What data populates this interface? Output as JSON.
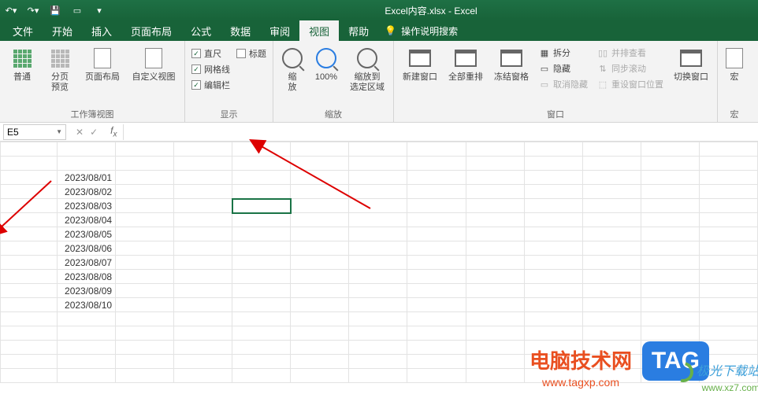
{
  "title": "Excel内容.xlsx - Excel",
  "tabs": {
    "file": "文件",
    "home": "开始",
    "insert": "插入",
    "layout": "页面布局",
    "formula": "公式",
    "data": "数据",
    "review": "审阅",
    "view": "视图",
    "help": "帮助",
    "search": "操作说明搜索"
  },
  "ribbon": {
    "groups": {
      "workbook_views": {
        "label": "工作簿视图",
        "normal": "普通",
        "page_break": "分页\n预览",
        "page_layout": "页面布局",
        "custom": "自定义视图"
      },
      "show": {
        "label": "显示",
        "ruler": "直尺",
        "gridlines": "网格线",
        "formulabar": "编辑栏",
        "headings": "标题"
      },
      "zoom": {
        "label": "缩放",
        "zoom": "缩\n放",
        "hundred": "100%",
        "selection": "缩放到\n选定区域"
      },
      "window": {
        "label": "窗口",
        "new_win": "新建窗口",
        "arrange": "全部重排",
        "freeze": "冻结窗格",
        "split": "拆分",
        "hide": "隐藏",
        "unhide": "取消隐藏",
        "side": "并排查看",
        "sync": "同步滚动",
        "reset": "重设窗口位置",
        "switch": "切换窗口"
      },
      "macro": {
        "label": "宏",
        "macro": "宏"
      }
    }
  },
  "namebox": "E5",
  "cells": [
    "2023/08/01",
    "2023/08/02",
    "2023/08/03",
    "2023/08/04",
    "2023/08/05",
    "2023/08/06",
    "2023/08/07",
    "2023/08/08",
    "2023/08/09",
    "2023/08/10"
  ],
  "watermark": {
    "title": "电脑技术网",
    "url": "www.tagxp.com",
    "tag": "TAG",
    "site": "极光下载站",
    "siteurl": "www.xz7.com"
  }
}
